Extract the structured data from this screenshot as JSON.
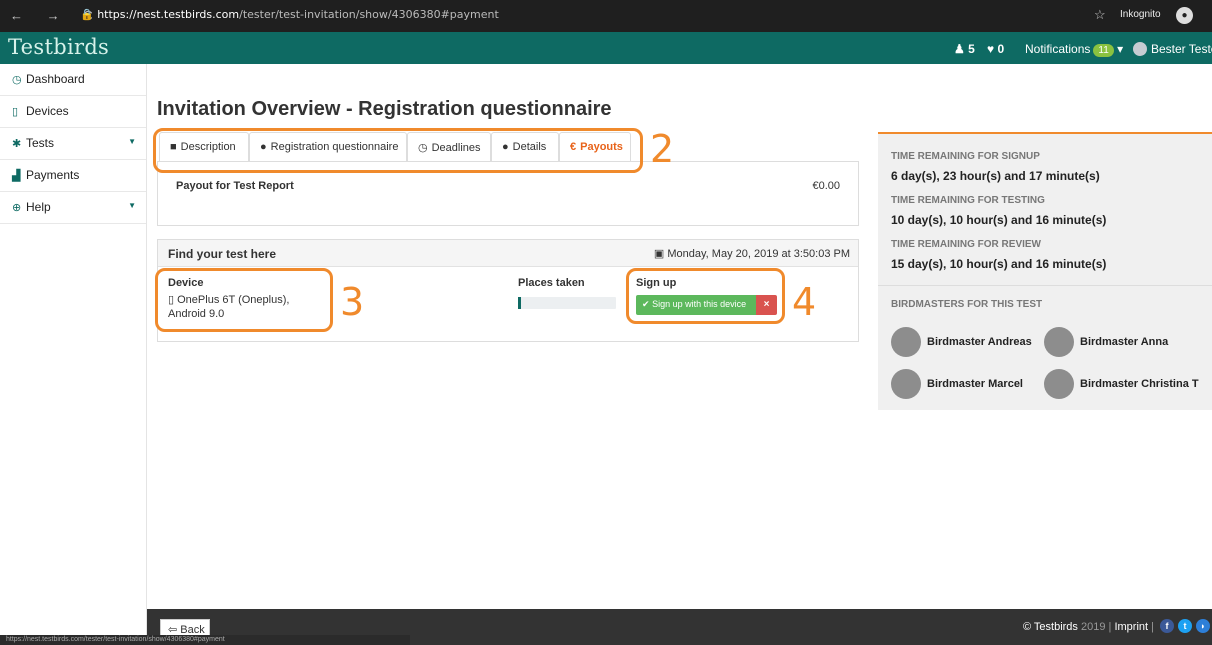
{
  "browser": {
    "url_host": "https://nest.testbirds.com",
    "url_path": "/tester/test-invitation/show/4306380#payment",
    "nav_icons": "← → C",
    "mode_label": "Inkognito"
  },
  "header": {
    "logo": "Testbirds",
    "level_count": "5",
    "likes_count": "0",
    "notifications_label": "Notifications",
    "notifications_count": "11",
    "user_name": "Bester Tester"
  },
  "sidebar": {
    "items": [
      {
        "label": "Dashboard"
      },
      {
        "label": "Devices"
      },
      {
        "label": "Tests"
      },
      {
        "label": "Payments"
      },
      {
        "label": "Help"
      }
    ]
  },
  "page": {
    "title": "Invitation Overview - Registration questionnaire",
    "tabs": [
      {
        "label": "Description"
      },
      {
        "label": "Registration questionnaire"
      },
      {
        "label": "Deadlines"
      },
      {
        "label": "Details"
      },
      {
        "label": "Payouts"
      }
    ]
  },
  "payout": {
    "label": "Payout for Test Report",
    "value": "€0.00"
  },
  "find": {
    "title": "Find your test here",
    "date": "Monday, May 20, 2019 at 3:50:03 PM",
    "device_header": "Device",
    "device_value": "OnePlus 6T (Oneplus), Android 9.0",
    "places_header": "Places taken",
    "places_fraction": 0.03,
    "signup_header": "Sign up",
    "signup_button": "Sign up with this device",
    "cancel_button": "×"
  },
  "annotations": [
    "2",
    "3",
    "4"
  ],
  "right_panel": {
    "signup_label": "TIME REMAINING FOR SIGNUP",
    "signup_value": "6 day(s), 23 hour(s) and 17 minute(s)",
    "testing_label": "TIME REMAINING FOR TESTING",
    "testing_value": "10 day(s), 10 hour(s) and 16 minute(s)",
    "review_label": "TIME REMAINING FOR REVIEW",
    "review_value": "15 day(s), 10 hour(s) and 16 minute(s)",
    "birdmasters_label": "BIRDMASTERS FOR THIS TEST",
    "birdmasters": [
      {
        "name": "Birdmaster Andreas"
      },
      {
        "name": "Birdmaster Anna"
      },
      {
        "name": "Birdmaster Marcel"
      },
      {
        "name": "Birdmaster Christina T"
      }
    ]
  },
  "footer": {
    "back_label": "Back",
    "brand": "© Testbirds",
    "year": "2019",
    "imprint": "Imprint"
  },
  "status_url": "https://nest.testbirds.com/tester/test-invitation/show/4306380#payment",
  "colors": {
    "brand": "#0e6a63",
    "accent": "#f08a2c",
    "success": "#5cb85c",
    "danger": "#d9534f"
  }
}
